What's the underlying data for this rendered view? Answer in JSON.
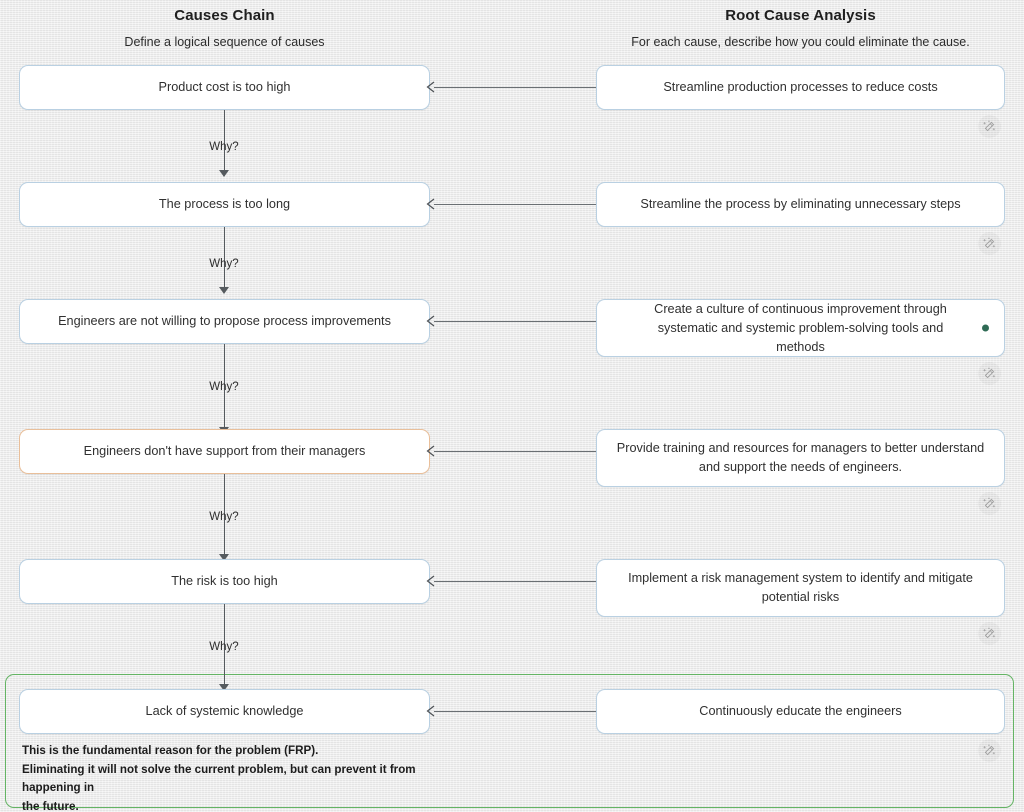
{
  "columns": {
    "causes": {
      "title": "Causes Chain",
      "subtitle": "Define a logical sequence of causes"
    },
    "root": {
      "title": "Root Cause Analysis",
      "subtitle": "For each cause, describe how you could eliminate the cause."
    }
  },
  "connector_label": "Why?",
  "colors": {
    "background": "#e9e9e9",
    "card_border": "#b9d0e2",
    "card_border_highlight": "#e9bf9a",
    "frp_border": "#64b464",
    "marker_dot": "#2f6b55",
    "connector": "#555a5e",
    "text": "#303030"
  },
  "rows": [
    {
      "cause": "Product cost is too high",
      "solution": "Streamline production processes to reduce costs",
      "cause_highlight": false,
      "solution_dot": false
    },
    {
      "cause": "The process is too long",
      "solution": "Streamline the process by eliminating unnecessary steps",
      "cause_highlight": false,
      "solution_dot": false
    },
    {
      "cause": "Engineers are not willing to propose process improvements",
      "solution": "Create a culture of continuous improvement through systematic and systemic problem-solving tools and methods",
      "cause_highlight": false,
      "solution_dot": true
    },
    {
      "cause": "Engineers don't have support from their managers",
      "solution": "Provide training and resources for managers to better understand and support the needs of engineers.",
      "cause_highlight": true,
      "solution_dot": false
    },
    {
      "cause": "The risk is too high",
      "solution": "Implement a risk management system to identify and mitigate potential risks",
      "cause_highlight": false,
      "solution_dot": false
    },
    {
      "cause": "Lack of systemic knowledge",
      "solution": "Continuously educate the engineers",
      "cause_highlight": false,
      "solution_dot": false
    }
  ],
  "frp_note": {
    "line1": "This is the fundamental reason for the problem (FRP).",
    "line2": "Eliminating it will not solve the current problem, but can prevent it from happening in",
    "line3": "the future."
  },
  "icons": {
    "wand": "magic-wand-icon",
    "arrow_left": "arrow-left-icon",
    "arrow_down": "arrow-down-icon"
  }
}
